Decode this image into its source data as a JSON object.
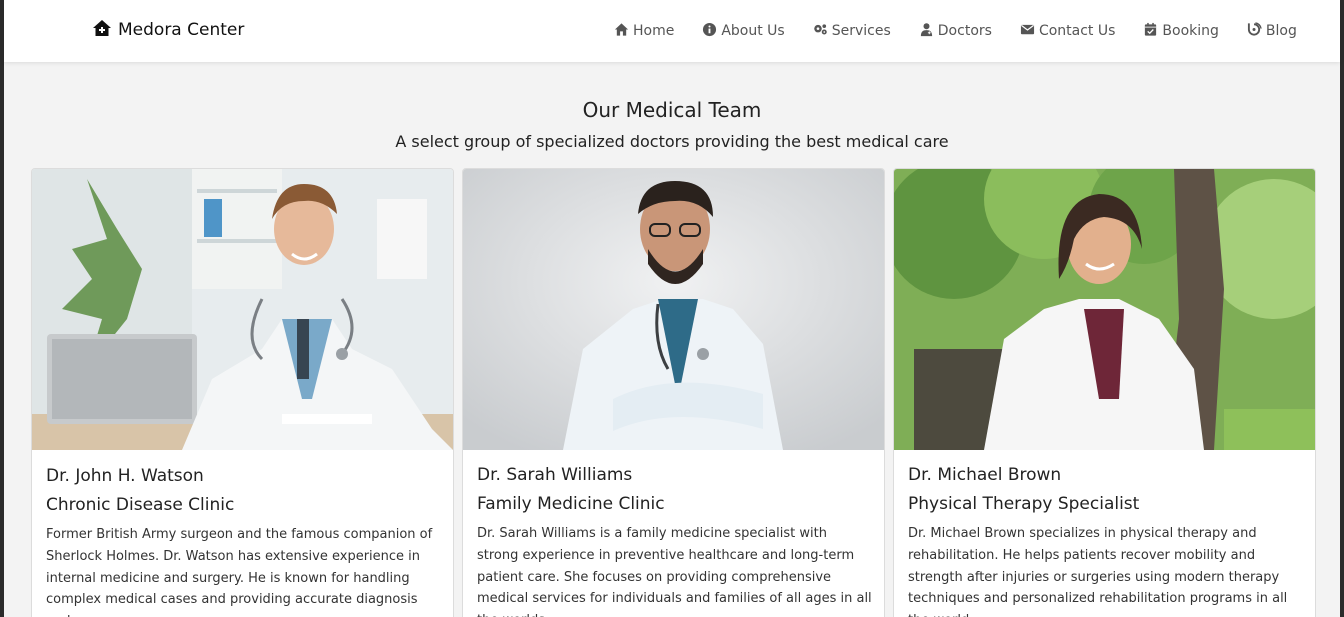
{
  "brand": {
    "name": "Medora Center",
    "icon": "house-medical-icon"
  },
  "nav": {
    "items": [
      {
        "label": "Home",
        "icon": "home-icon"
      },
      {
        "label": "About Us",
        "icon": "info-circle-icon"
      },
      {
        "label": "Services",
        "icon": "gears-icon"
      },
      {
        "label": "Doctors",
        "icon": "user-doctor-icon"
      },
      {
        "label": "Contact Us",
        "icon": "envelope-icon"
      },
      {
        "label": "Booking",
        "icon": "calendar-check-icon"
      },
      {
        "label": "Blog",
        "icon": "blog-icon"
      }
    ]
  },
  "team": {
    "title": "Our Medical Team",
    "subtitle": "A select group of specialized doctors providing the best medical care",
    "doctors": [
      {
        "name": "Dr. John H. Watson",
        "specialty": "Chronic Disease Clinic",
        "description": "Former British Army surgeon and the famous companion of Sherlock Holmes. Dr. Watson has extensive experience in internal medicine and surgery. He is known for handling complex medical cases and providing accurate diagnosis and"
      },
      {
        "name": "Dr. Sarah Williams",
        "specialty": "Family Medicine Clinic",
        "description": "Dr. Sarah Williams is a family medicine specialist with strong experience in preventive healthcare and long-term patient care. She focuses on providing comprehensive medical services for individuals and families of all ages in all the worlds."
      },
      {
        "name": "Dr. Michael Brown",
        "specialty": "Physical Therapy Specialist",
        "description": "Dr. Michael Brown specializes in physical therapy and rehabilitation. He helps patients recover mobility and strength after injuries or surgeries using modern therapy techniques and personalized rehabilitation programs in all the world."
      }
    ]
  },
  "colors": {
    "navbar_bg": "#ffffff",
    "page_bg": "#f3f3f3",
    "text": "#222222",
    "nav_text": "#555555"
  }
}
